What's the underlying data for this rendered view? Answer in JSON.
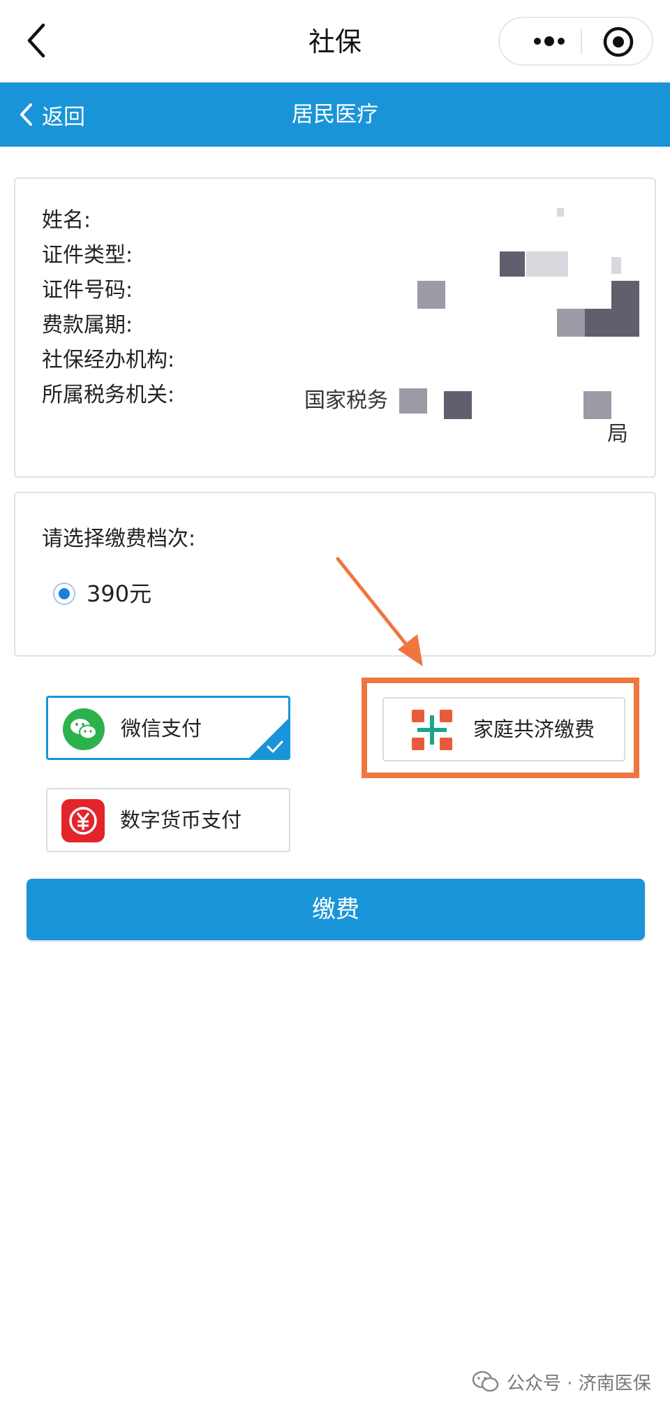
{
  "topbar": {
    "title": "社保"
  },
  "header": {
    "back_label": "返回",
    "title": "居民医疗"
  },
  "info": {
    "name_label": "姓名:",
    "id_type_label": "证件类型:",
    "id_number_label": "证件号码:",
    "period_label": "费款属期:",
    "agency_label": "社保经办机构:",
    "tax_label": "所属税务机关:",
    "tax_value_prefix": "国家税务",
    "tax_value_suffix": "局"
  },
  "tier": {
    "label": "请选择缴费档次:",
    "selected_value": "390元"
  },
  "payment": {
    "wechat_label": "微信支付",
    "dcep_label": "数字货币支付",
    "family_label": "家庭共济缴费",
    "selected": "微信支付"
  },
  "submit": {
    "label": "缴费"
  },
  "watermark": {
    "text": "公众号 · 济南医保"
  },
  "colors": {
    "primary": "#1a94d8",
    "highlight": "#f0753f",
    "wechat_green": "#2bb24c",
    "dcep_red": "#e3242b"
  }
}
